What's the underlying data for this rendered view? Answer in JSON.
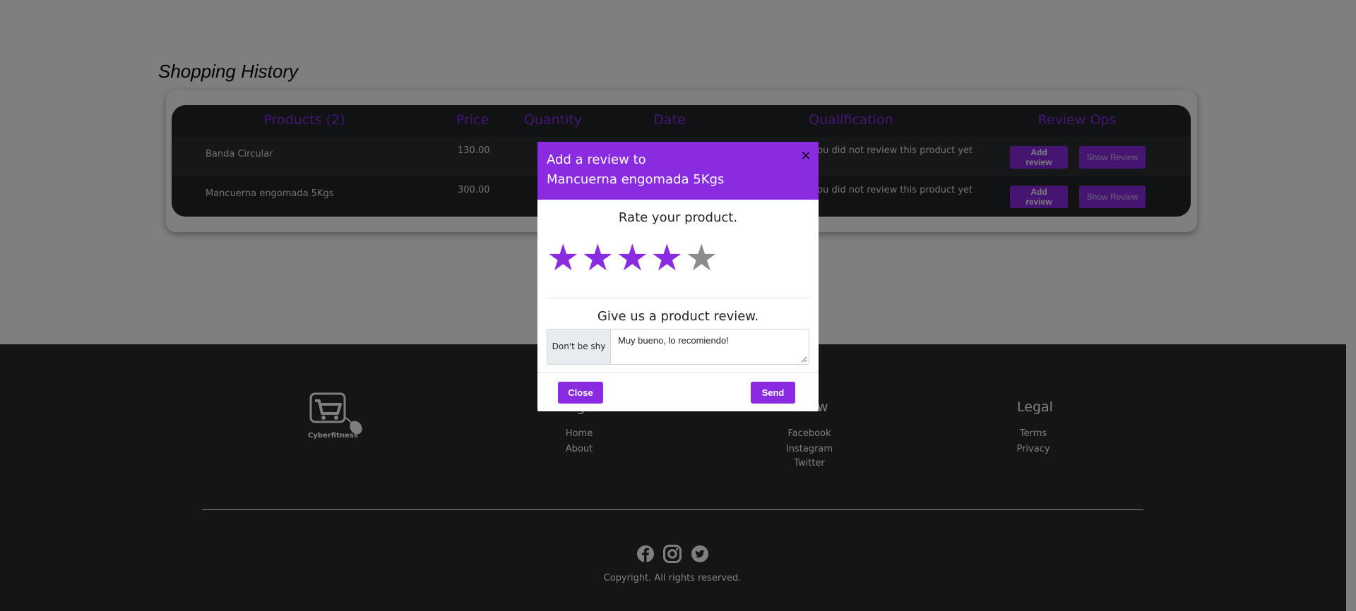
{
  "page": {
    "title": "Shopping History"
  },
  "table": {
    "headers": [
      "Products (2)",
      "Price",
      "Quantity",
      "Date",
      "Qualification",
      "Review Ops"
    ],
    "rows": [
      {
        "product": "Banda Circular",
        "price": "130.00",
        "qualification": "You did not review this product yet",
        "add_label": "Add review",
        "show_label": "Show Review"
      },
      {
        "product": "Mancuerna engomada 5Kgs",
        "price": "300.00",
        "qualification": "You did not review this product yet",
        "add_label": "Add review",
        "show_label": "Show Review"
      }
    ]
  },
  "footer": {
    "logo_text": "Cyberfitness",
    "columns": [
      {
        "title": "Pages",
        "links": [
          "Home",
          "About"
        ]
      },
      {
        "title": "Follow",
        "links": [
          "Facebook",
          "Instagram",
          "Twitter"
        ]
      },
      {
        "title": "Legal",
        "links": [
          "Terms",
          "Privacy"
        ]
      }
    ],
    "social_icons": [
      "facebook-icon",
      "instagram-icon",
      "twitter-icon"
    ],
    "copyright": "Copyright. All rights reserved."
  },
  "modal": {
    "title_line1": "Add a review to",
    "title_line2": "Mancuerna engomada 5Kgs",
    "close_x": "×",
    "rate_title": "Rate your product.",
    "rating": 4,
    "rating_max": 5,
    "star_glyph": "★",
    "review_title": "Give us a product review.",
    "addon_label": "Don't be shy",
    "review_value": "Muy bueno, lo recomiendo!",
    "close_label": "Close",
    "send_label": "Send"
  },
  "colors": {
    "accent": "#8a2be2",
    "star_empty": "#8c8c8c",
    "table_bg": "#212529",
    "footer_bg": "#2b2b2b"
  }
}
